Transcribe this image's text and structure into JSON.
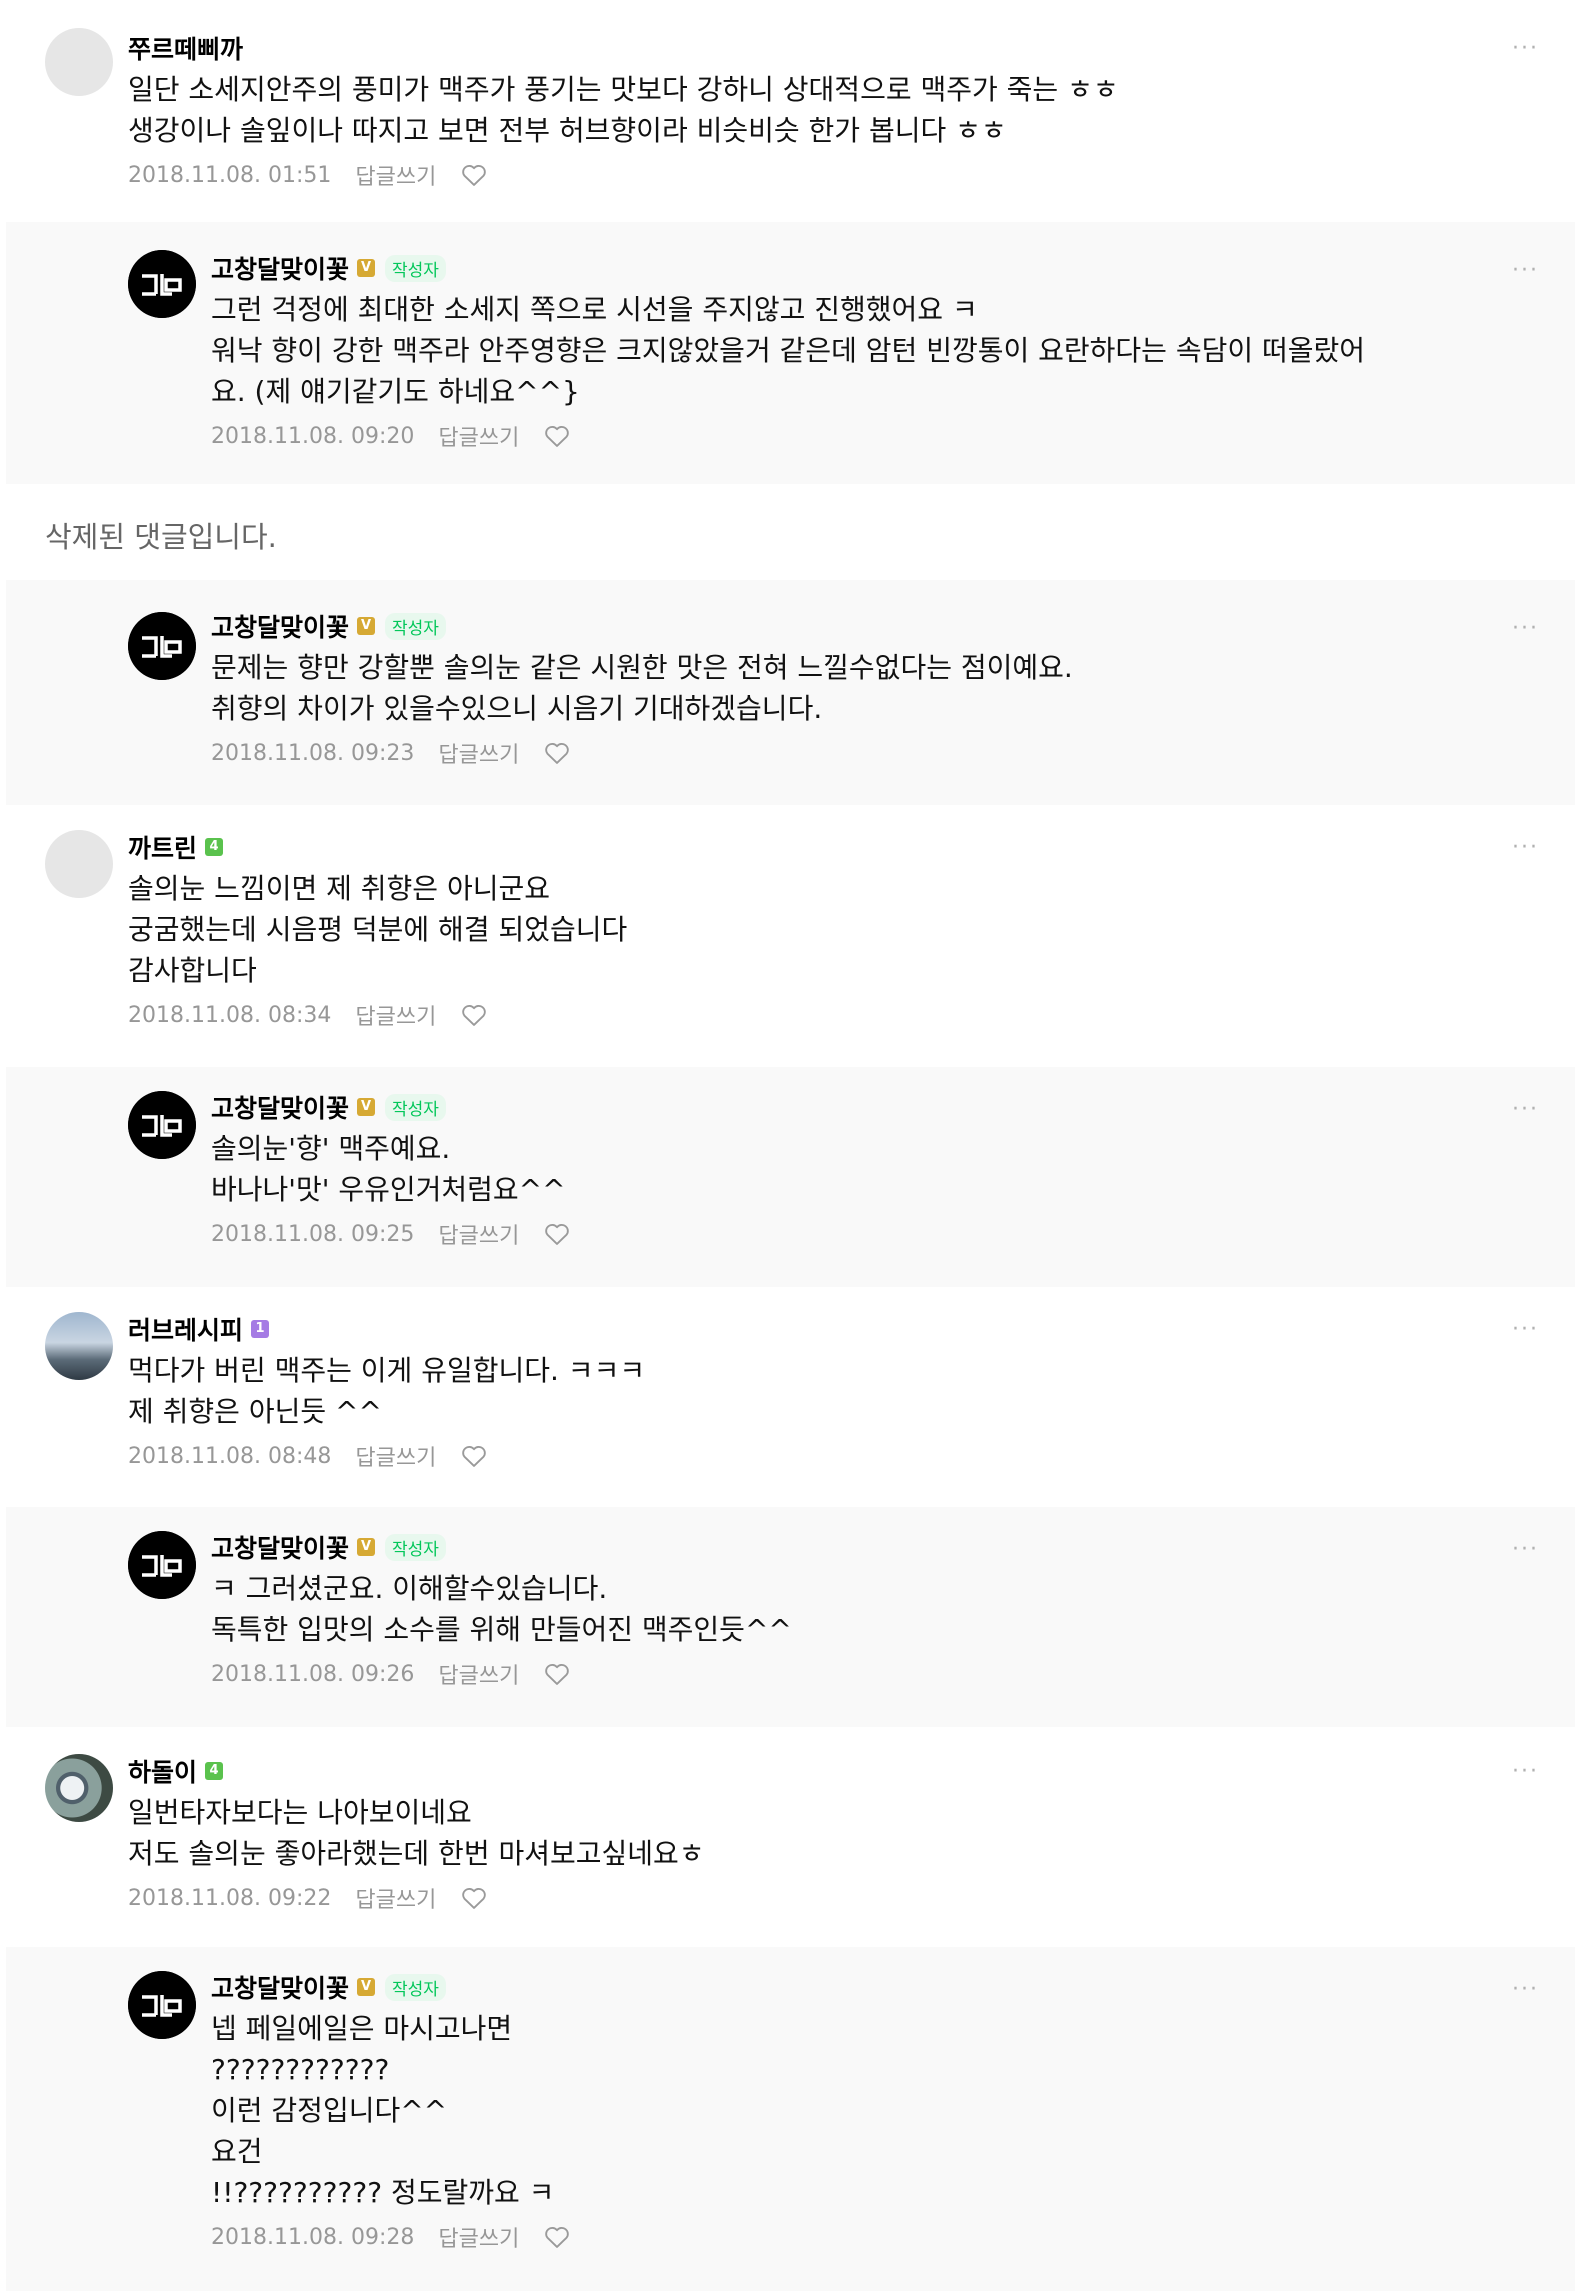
{
  "ui": {
    "reply_label": "답글쓰기",
    "author_tag": "작성자",
    "more_glyph": "···",
    "author_avatar_text": "고달",
    "deleted_text": "삭제된 댓글입니다."
  },
  "comments": [
    {
      "kind": "top",
      "nick": "쭈르떼삐까",
      "badge": "",
      "avatar": "default",
      "text": "일단 소세지안주의 풍미가 맥주가 풍기는 맛보다 강하니 상대적으로 맥주가 죽는 ㅎㅎ\n생강이나 솔잎이나 따지고 보면 전부 허브향이라 비슷비슷 한가 봅니다 ㅎㅎ",
      "date": "2018.11.08. 01:51"
    },
    {
      "kind": "reply",
      "nick": "고창달맞이꽃",
      "badge": "V",
      "avatar": "author",
      "is_author": true,
      "text": "그런 걱정에 최대한 소세지 쪽으로 시선을 주지않고 진행했어요 ㅋ\n워낙 향이 강한 맥주라 안주영향은 크지않았을거 같은데 암턴 빈깡통이 요란하다는 속담이 떠올랐어\n요. (제 얘기같기도 하네요^^}",
      "date": "2018.11.08. 09:20"
    },
    {
      "kind": "deleted"
    },
    {
      "kind": "reply",
      "nick": "고창달맞이꽃",
      "badge": "V",
      "avatar": "author",
      "is_author": true,
      "text": "문제는 향만 강할뿐 솔의눈 같은 시원한 맛은 전혀 느낄수없다는 점이예요.\n취향의 차이가 있을수있으니 시음기 기대하겠습니다.",
      "date": "2018.11.08. 09:23"
    },
    {
      "kind": "top",
      "nick": "까트린",
      "badge": "4",
      "badge_style": "g",
      "avatar": "default",
      "text": "솔의눈 느낌이면 제 취향은 아니군요\n궁굼했는데 시음평 덕분에 해결 되었습니다\n감사합니다",
      "date": "2018.11.08. 08:34"
    },
    {
      "kind": "reply",
      "nick": "고창달맞이꽃",
      "badge": "V",
      "avatar": "author",
      "is_author": true,
      "text": "솔의눈'향' 맥주예요.\n바나나'맛' 우유인거처럼요^^",
      "date": "2018.11.08. 09:25"
    },
    {
      "kind": "top",
      "nick": "러브레시피",
      "badge": "1",
      "badge_style": "p",
      "avatar": "photo-sky",
      "text": "먹다가 버린 맥주는 이게 유일합니다. ㅋㅋㅋ\n제 취향은 아닌듯 ^^",
      "date": "2018.11.08. 08:48"
    },
    {
      "kind": "reply",
      "nick": "고창달맞이꽃",
      "badge": "V",
      "avatar": "author",
      "is_author": true,
      "text": "ㅋ 그러셨군요. 이해할수있습니다.\n독특한 입맛의 소수를 위해 만들어진 맥주인듯^^",
      "date": "2018.11.08. 09:26"
    },
    {
      "kind": "top",
      "nick": "하돌이",
      "badge": "4",
      "badge_style": "g",
      "avatar": "photo-sign",
      "text": "일번타자보다는 나아보이네요\n저도 솔의눈 좋아라했는데 한번 마셔보고싶네요ㅎ",
      "date": "2018.11.08. 09:22"
    },
    {
      "kind": "reply",
      "nick": "고창달맞이꽃",
      "badge": "V",
      "avatar": "author",
      "is_author": true,
      "text": "넵 페일에일은 마시고나면\n????????????\n이런 감정입니다^^\n요건\n!!?????????? 정도랄까요 ㅋ",
      "date": "2018.11.08. 09:28"
    }
  ]
}
